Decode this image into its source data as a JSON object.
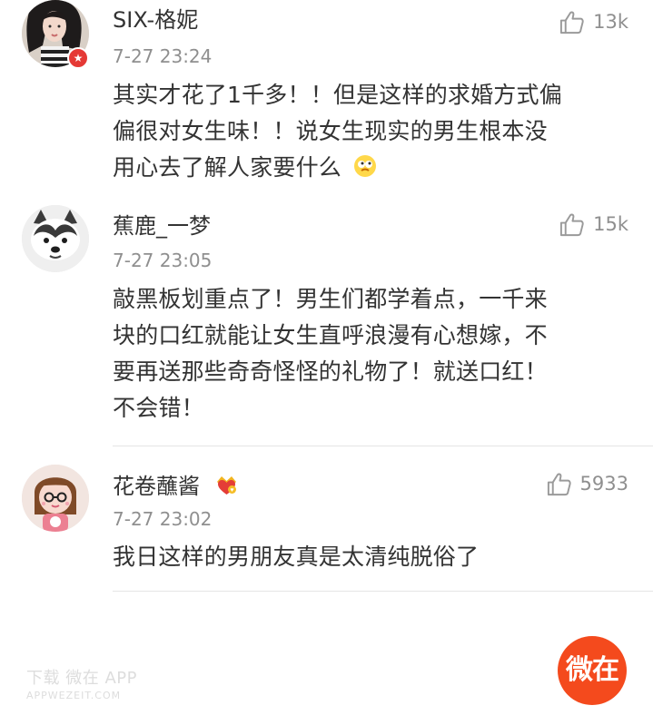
{
  "comments": [
    {
      "username": "SIX-格妮",
      "time": "7-27 23:24",
      "likes": "13k",
      "content_lines": [
        "其实才花了1千多！！但是这样的求婚方式偏",
        "偏很对女生味！！说女生现实的男生根本没",
        "用心去了解人家要什么"
      ],
      "emoji": "thinking-face",
      "verified_badge": true,
      "badge_color": "#e53935"
    },
    {
      "username": "蕉鹿_一梦",
      "time": "7-27 23:05",
      "likes": "15k",
      "content_lines": [
        "敲黑板划重点了！男生们都学着点，一千来",
        "块的口红就能让女生直呼浪漫有心想嫁，不",
        "要再送那些奇奇怪怪的礼物了！就送口红！",
        "不会错！"
      ]
    },
    {
      "username": "花卷蘸酱",
      "time": "7-27 23:02",
      "likes": "5933",
      "content_lines": [
        "我日这样的男朋友真是太清纯脱俗了"
      ],
      "name_badge": "crown-heart-badge"
    }
  ],
  "watermark": {
    "main": "下载 微在 APP",
    "sub": "APPWEZEIT.COM"
  },
  "bottom_button": {
    "label": "微在",
    "color": "#f44a1d"
  },
  "colors": {
    "text": "#333333",
    "secondary": "#8f8f8f",
    "separator": "#e5e5e5"
  },
  "icons": {
    "like": "thumb-up-icon",
    "crown": "crown-heart-badge"
  }
}
